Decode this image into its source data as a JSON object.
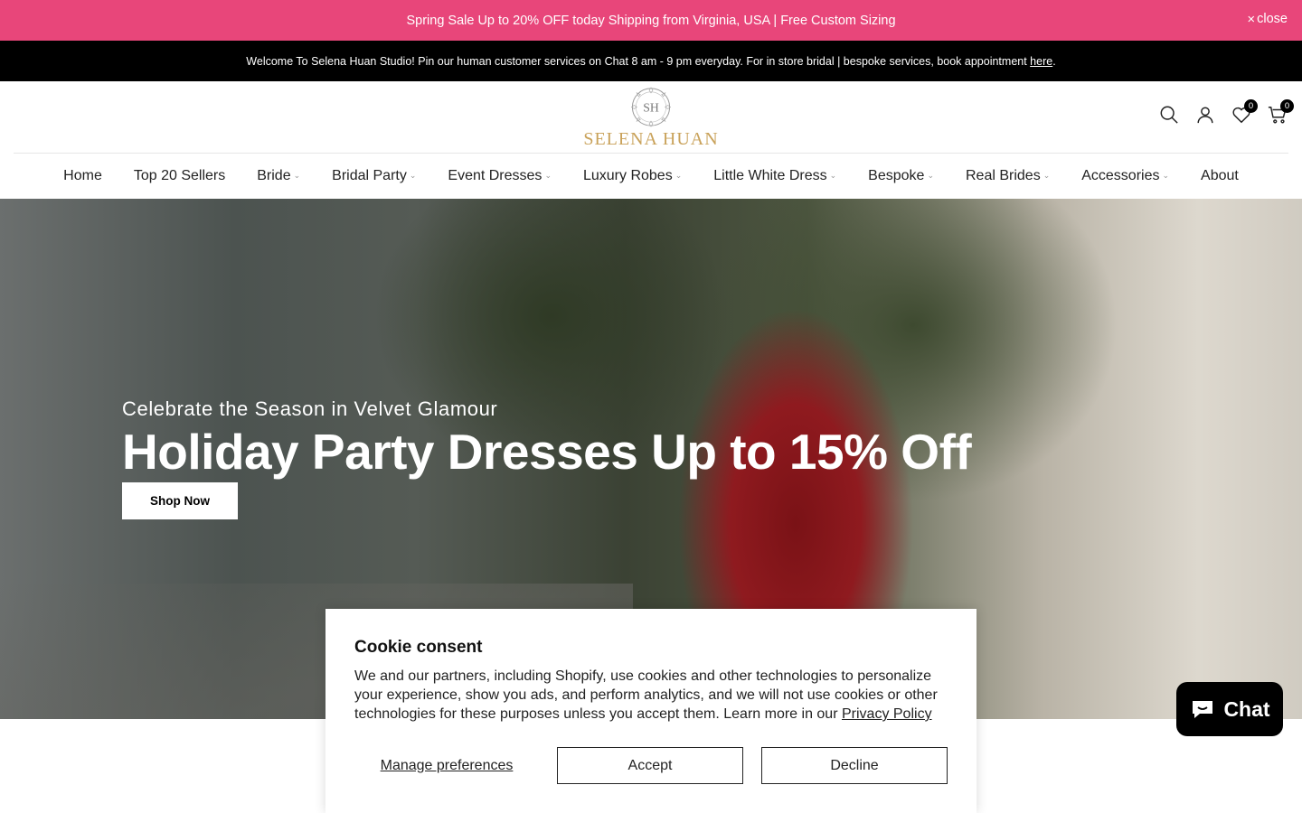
{
  "promo": {
    "text": "Spring Sale Up to 20% OFF today Shipping from Virginia, USA | Free Custom Sizing",
    "close_label": "close"
  },
  "welcome": {
    "text": "Welcome To Selena Huan Studio! Pin our human customer services on Chat 8 am - 9 pm everyday. For in store bridal | bespoke services, book appointment ",
    "link": "here",
    "suffix": "."
  },
  "header": {
    "logo_monogram": "SH",
    "logo_text": "SELENA HUAN",
    "wishlist_count": "0",
    "cart_count": "0"
  },
  "nav": {
    "items": [
      {
        "label": "Home"
      },
      {
        "label": "Top 20 Sellers"
      },
      {
        "label": "Bride"
      },
      {
        "label": "Bridal Party"
      },
      {
        "label": "Event Dresses"
      },
      {
        "label": "Luxury Robes"
      },
      {
        "label": "Little White Dress"
      },
      {
        "label": "Bespoke"
      },
      {
        "label": "Real Brides"
      },
      {
        "label": "Accessories"
      },
      {
        "label": "About"
      }
    ]
  },
  "hero": {
    "subtitle": "Celebrate the Season in Velvet Glamour",
    "title": "Holiday Party Dresses Up to 15% Off",
    "button": "Shop Now"
  },
  "cookie": {
    "title": "Cookie consent",
    "body": "We and our partners, including Shopify, use cookies and other technologies to personalize your experience, show you ads, and perform analytics, and we will not use cookies or other technologies for these purposes unless you accept them. Learn more in our ",
    "policy_link": "Privacy Policy",
    "manage": "Manage preferences",
    "accept": "Accept",
    "decline": "Decline"
  },
  "chat": {
    "label": "Chat"
  },
  "colors": {
    "promo_bg": "#e8467a",
    "welcome_bg": "#000000",
    "logo_gold": "#c9a25a"
  }
}
